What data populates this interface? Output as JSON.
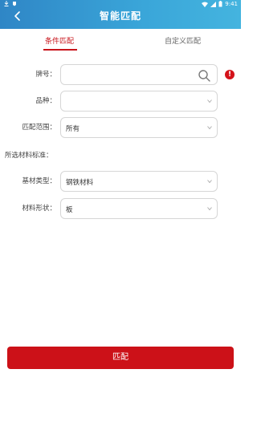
{
  "status_bar": {
    "time": "9:41"
  },
  "header": {
    "title": "智能匹配"
  },
  "tabs": [
    {
      "label": "条件匹配",
      "active": true
    },
    {
      "label": "自定义匹配",
      "active": false
    }
  ],
  "form": {
    "brand": {
      "label": "牌号：",
      "value": ""
    },
    "variety": {
      "label": "品种：",
      "value": ""
    },
    "match_range": {
      "label": "匹配范围：",
      "value": "所有"
    },
    "selected_standard_label": "所选材料标准：",
    "base_material_type": {
      "label": "基材类型：",
      "value": "钢铁材料"
    },
    "material_shape": {
      "label": "材料形状：",
      "value": "板"
    }
  },
  "info_badge": "!",
  "match_button": {
    "label": "匹配"
  },
  "colors": {
    "header": "#3aa6d9",
    "accent": "#c8141b"
  }
}
